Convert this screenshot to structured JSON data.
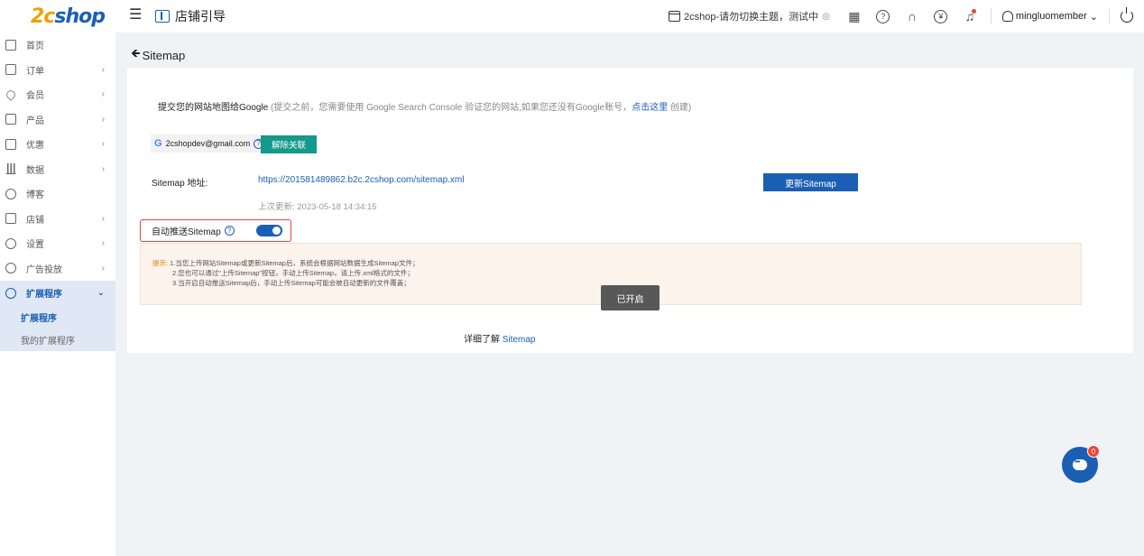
{
  "header": {
    "logo_mark": "2c",
    "logo_text": "shop",
    "menu_icon": "menu-toggle-icon",
    "page_title": "店铺引导",
    "store_switch": "2cshop-请勿切换主题，测试中",
    "user": "mingluomember",
    "user_chevron": "⌄",
    "icons": [
      "store-icon",
      "qr-code-icon",
      "help-icon",
      "headset-icon",
      "currency-icon",
      "bell-icon",
      "user-icon",
      "power-icon"
    ]
  },
  "sidebar": {
    "items": [
      {
        "label": "首页",
        "icon": "home-icon",
        "has_children": false
      },
      {
        "label": "订单",
        "icon": "order-icon",
        "has_children": true
      },
      {
        "label": "会员",
        "icon": "member-icon",
        "has_children": true
      },
      {
        "label": "产品",
        "icon": "product-icon",
        "has_children": true
      },
      {
        "label": "优惠",
        "icon": "discount-icon",
        "has_children": true
      },
      {
        "label": "数据",
        "icon": "data-icon",
        "has_children": true
      },
      {
        "label": "博客",
        "icon": "blog-icon",
        "has_children": false
      },
      {
        "label": "店铺",
        "icon": "store-icon",
        "has_children": true
      },
      {
        "label": "设置",
        "icon": "settings-icon",
        "has_children": true
      },
      {
        "label": "广告投放",
        "icon": "ads-icon",
        "has_children": true
      },
      {
        "label": "扩展程序",
        "icon": "extensions-icon",
        "has_children": true,
        "expanded": true
      }
    ],
    "sub_items": [
      "扩展程序",
      "我的扩展程序"
    ],
    "chevron": "›",
    "chevron_open": "⌄"
  },
  "main": {
    "back_label": "Sitemap",
    "google_intro": {
      "lead": "提交您的网站地图给Google",
      "note": " (提交之前，您需要使用 Google Search Console 验证您的网站,如果您还没有Google账号，",
      "link": "点击这里",
      "tail": " 创建)"
    },
    "account_email": "2cshopdev@gmail.com",
    "unlink_label": "解除关联",
    "sitemap_label": "Sitemap 地址:",
    "sitemap_url": "https://201581489862.b2c.2cshop.com/sitemap.xml",
    "update_label": "更新Sitemap",
    "last_update": "上次更新: 2023-05-18 14:34:15",
    "auto_push_label": "自动推送Sitemap",
    "auto_push_on": true,
    "tips": {
      "label": "提示:",
      "lines": [
        " 1.当您上传网站Sitemap或更新Sitemap后，系统会根据网站数据生成Sitemap文件；",
        "2.您也可以通过\"上传Sitemap\"按钮，手动上传Sitemap，请上传.xml格式的文件；",
        "3.当开启自动推送Sitemap后，手动上传Sitemap可能会被自动更新的文件覆盖；"
      ]
    },
    "toast": "已开启",
    "learn_more": {
      "text": "详细了解 ",
      "link": "Sitemap"
    }
  },
  "chat": {
    "badge": "0",
    "icon": "chat-icon"
  },
  "colors": {
    "primary": "#1b5fb5",
    "teal": "#14998a",
    "highlight_border": "#e0463a",
    "tips_bg": "#fbf3ec",
    "tip_label": "#e08000"
  }
}
